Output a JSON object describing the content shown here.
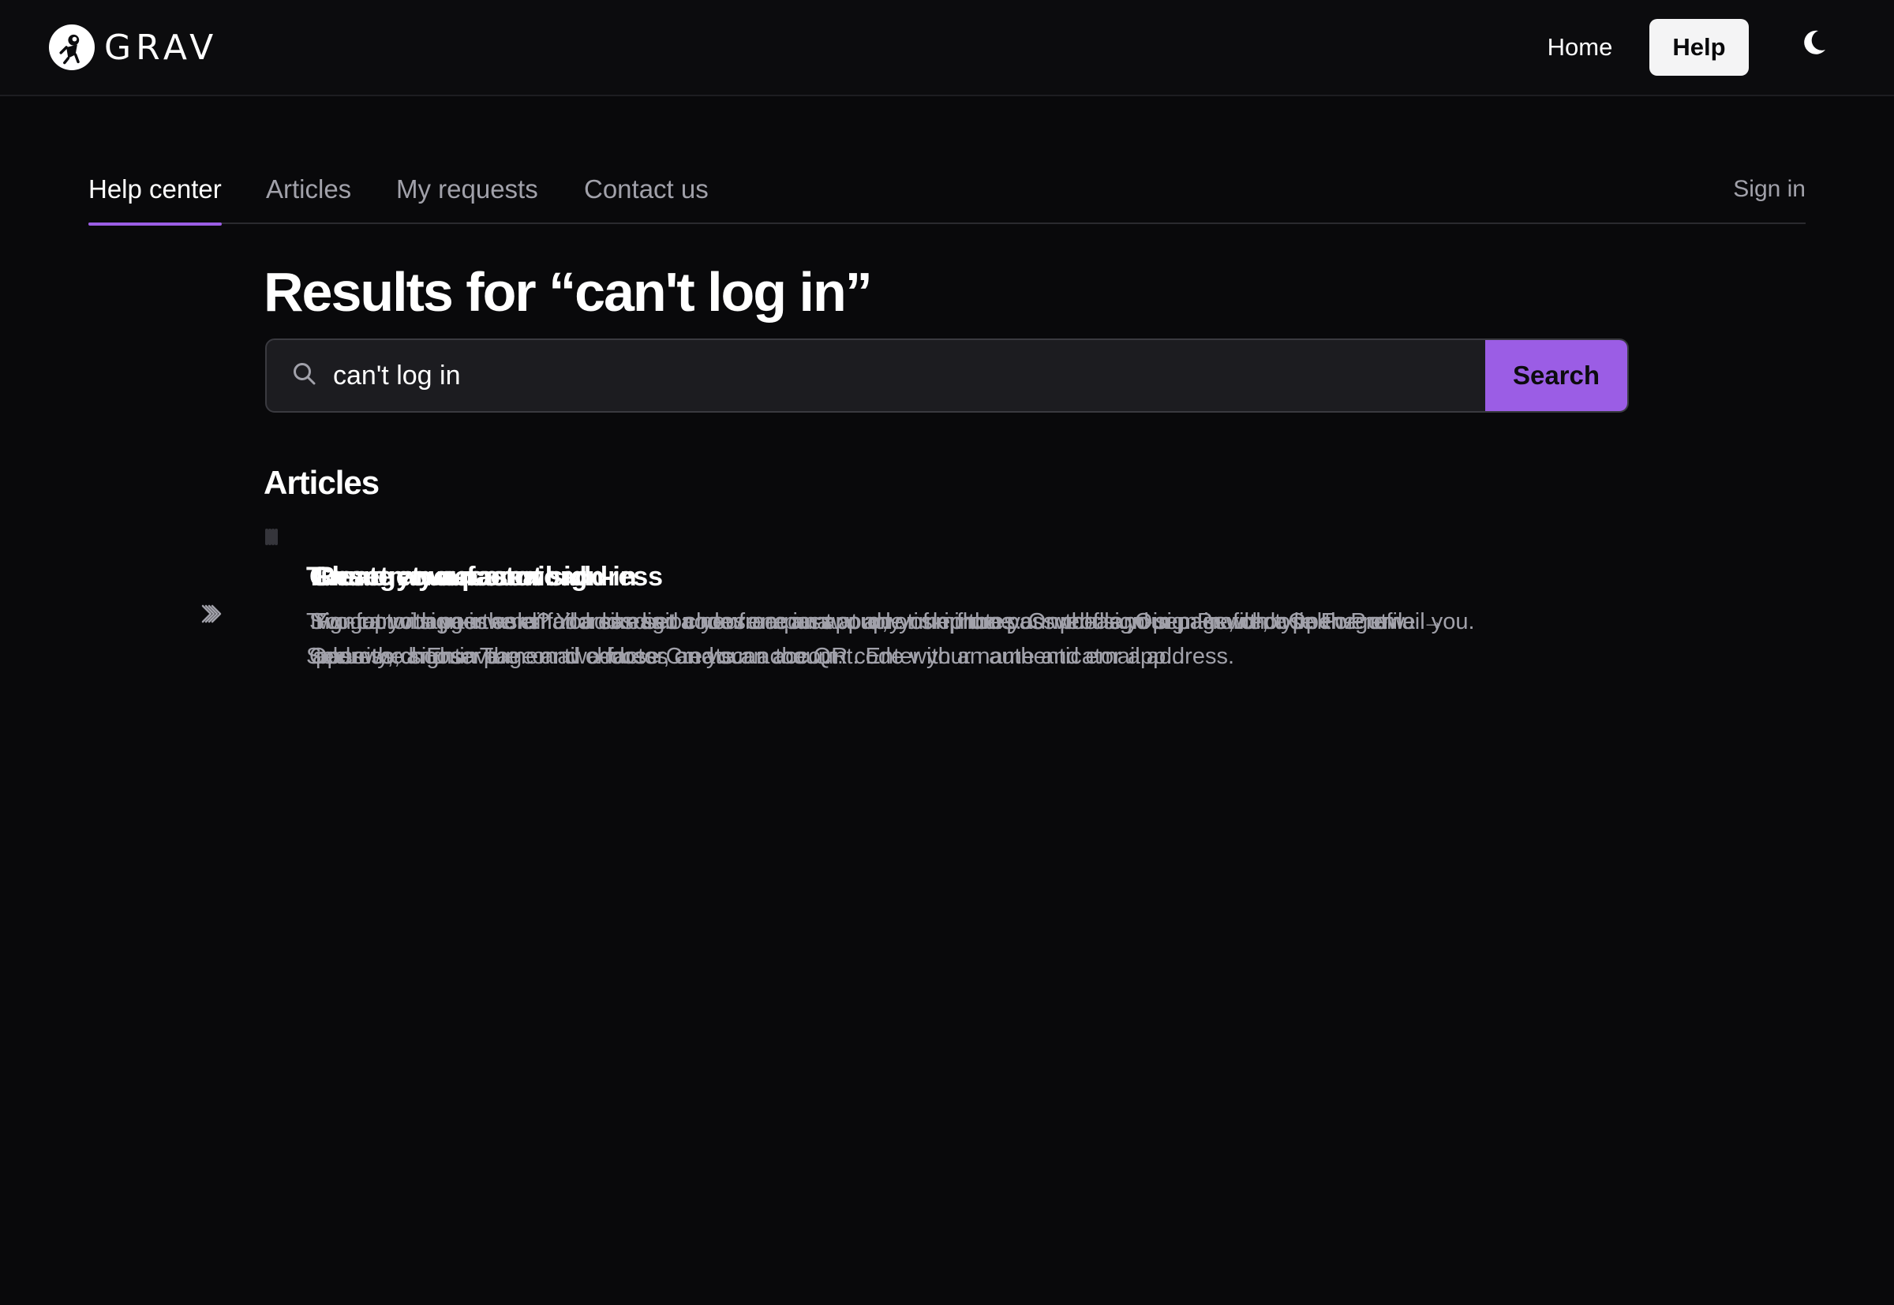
{
  "header": {
    "logo_text": "GRAV",
    "nav": {
      "home_label": "Home",
      "help_label": "Help"
    },
    "theme_icon": "moon-icon"
  },
  "subnav": {
    "tabs": [
      {
        "label": "Help center",
        "active": true
      },
      {
        "label": "Articles",
        "active": false
      },
      {
        "label": "My requests",
        "active": false
      },
      {
        "label": "Contact us",
        "active": false
      }
    ],
    "signin_label": "Sign in"
  },
  "main": {
    "title": "Results for “can't log in”",
    "search": {
      "value": "can't log in",
      "placeholder": "",
      "button_label": "Search"
    },
    "section_heading": "Articles",
    "articles": [
      {
        "title": "Turn on two-factor sign-in",
        "description": "Two-factor sign-in asks for a six-digit code from an app on your phone as well as your password. Open Profile → Security, choose Turn on two-factor, and scan the QR code with an authenticator app..."
      },
      {
        "title": "Create an account",
        "description": "Sign up with your email address and choose a password, or skip the password and sign in with a link we email you. Open the sign-in page and choose Create an account. Enter your name and email address."
      },
      {
        "title": "Change your email address",
        "description": "You can change the email address on your account at any time from your profile. Open Profile, type the new address, and save."
      },
      {
        "title": "Reset your password",
        "description": "Forgot your password? You can set a new one in a couple of minutes. On the sign-in page, choose Forgot password. Enter the email address on your account."
      }
    ]
  },
  "colors": {
    "accent": "#9b5de5",
    "background": "#09090b",
    "card": "#1e1e22",
    "muted_text": "#a1a1aa"
  }
}
